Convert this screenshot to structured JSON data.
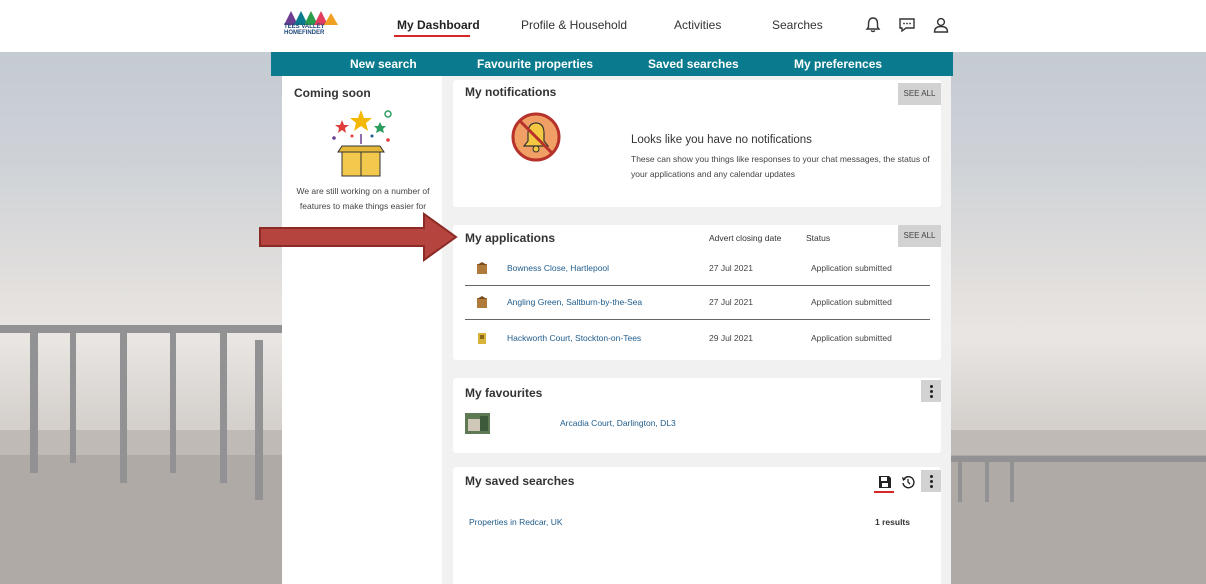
{
  "brand": {
    "logo_text": "TEES VALLEY HOMEFINDER"
  },
  "top_nav": [
    {
      "label": "My Dashboard",
      "active": true
    },
    {
      "label": "Profile & Household",
      "active": false
    },
    {
      "label": "Activities",
      "active": false
    },
    {
      "label": "Searches",
      "active": false
    }
  ],
  "top_icons": [
    "bell-icon",
    "chat-icon",
    "user-icon"
  ],
  "sub_nav": [
    "New search",
    "Favourite properties",
    "Saved searches",
    "My preferences"
  ],
  "coming_soon": {
    "title": "Coming soon",
    "text": "We are still working on a number of features to make things easier for"
  },
  "notifications": {
    "title": "My notifications",
    "see_all": "SEE ALL",
    "empty_heading": "Looks like you have no notifications",
    "empty_text": "These can show you things like responses to your chat messages, the status of your applications and any calendar updates"
  },
  "applications": {
    "title": "My applications",
    "see_all": "SEE ALL",
    "columns": [
      "Advert closing date",
      "Status"
    ],
    "rows": [
      {
        "address": "Bowness Close, Hartlepool",
        "closing_date": "27 Jul 2021",
        "status": "Application submitted"
      },
      {
        "address": "Angling Green, Saltburn-by-the-Sea",
        "closing_date": "27 Jul 2021",
        "status": "Application submitted"
      },
      {
        "address": "Hackworth Court, Stockton-on-Tees",
        "closing_date": "29 Jul 2021",
        "status": "Application submitted"
      }
    ]
  },
  "favourites": {
    "title": "My favourites",
    "items": [
      {
        "name": "Arcadia Court, Darlington, DL3"
      }
    ]
  },
  "saved_searches": {
    "title": "My saved searches",
    "items": [
      {
        "name": "Properties in Redcar, UK",
        "results": "1 results"
      }
    ]
  },
  "colors": {
    "teal": "#0a7b8e",
    "accent_red": "#d62828",
    "arrow": "#b5433e",
    "link": "#1f5c8c"
  }
}
